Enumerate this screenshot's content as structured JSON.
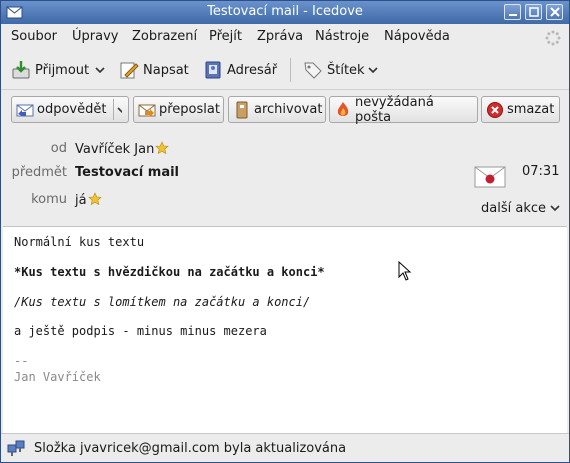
{
  "window": {
    "title": "Testovací mail - Icedove"
  },
  "menubar": {
    "items": [
      "Soubor",
      "Úpravy",
      "Zobrazení",
      "Přejít",
      "Zpráva",
      "Nástroje",
      "Nápověda"
    ]
  },
  "toolbar": {
    "get_mail": "Přijmout",
    "write": "Napsat",
    "address_book": "Adresář",
    "tag": "Štítek"
  },
  "message_buttons": {
    "reply": "odpovědět",
    "forward": "přeposlat",
    "archive": "archivovat",
    "junk": "nevyžádaná pošta",
    "delete": "smazat"
  },
  "header": {
    "from_label": "od",
    "from_value": "Vavříček Jan",
    "subject_label": "předmět",
    "subject_value": "Testovací mail",
    "to_label": "komu",
    "to_value": "já",
    "time": "07:31",
    "more_actions": "další akce"
  },
  "body": {
    "line1": "Normální kus textu",
    "line2": "*Kus textu s hvězdičkou na začátku a konci*",
    "line3": "/Kus textu s lomítkem na začátku a konci/",
    "line4": "a ještě podpis - minus minus mezera",
    "sig_sep": "-- ",
    "sig_name": "Jan Vavříček"
  },
  "status": {
    "text": "Složka jvavricek@gmail.com byla aktualizována"
  },
  "icons": [
    "app-icon",
    "minimize-icon",
    "maximize-icon",
    "close-icon",
    "spinner-icon",
    "download-mail-icon",
    "chevron-down-icon",
    "compose-icon",
    "address-book-icon",
    "tag-icon",
    "reply-icon",
    "forward-icon",
    "archive-icon",
    "junk-icon",
    "delete-icon",
    "star-icon",
    "envelope-seal-icon",
    "connection-icon"
  ]
}
